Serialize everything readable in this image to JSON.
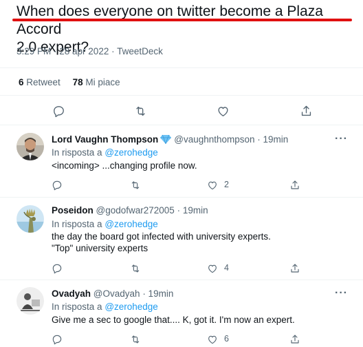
{
  "tweet": {
    "text_line1": "When does everyone on twitter become a Plaza Accord",
    "text_line2": "2.0 expert?",
    "meta": "3:29 PM · 28 apr 2022 · TweetDeck",
    "retweets_count": "6",
    "retweets_label": "Retweet",
    "likes_count": "78",
    "likes_label": "Mi piace",
    "actions": [
      "reply-icon",
      "retweet-icon",
      "like-icon",
      "share-icon"
    ]
  },
  "replies": [
    {
      "name": "Lord Vaughn Thompson",
      "handle": "@vaughnthompson",
      "time": "· 19min",
      "reply_prefix": "In risposta a",
      "reply_to": "@zerohedge",
      "lines": [
        "<incoming> ...changing profile now."
      ],
      "like_count": "2",
      "verified_icon": "diamond-icon"
    },
    {
      "name": "Poseidon",
      "handle": "@godofwar272005",
      "time": "· 19min",
      "reply_prefix": "In risposta a",
      "reply_to": "@zerohedge",
      "lines": [
        "the day the board got infected with university experts.",
        "\"Top\" university experts"
      ],
      "like_count": "4"
    },
    {
      "name": "Ovadyah",
      "handle": "@Ovadyah",
      "time": "· 19min",
      "reply_prefix": "In risposta a",
      "reply_to": "@zerohedge",
      "lines": [
        "Give me a sec to google that.... K, got it. I'm now an expert."
      ],
      "like_count": "6"
    }
  ],
  "more_label": "···",
  "colors": {
    "link": "#1d9bf0",
    "muted": "#536471",
    "highlight": "#e01010"
  }
}
